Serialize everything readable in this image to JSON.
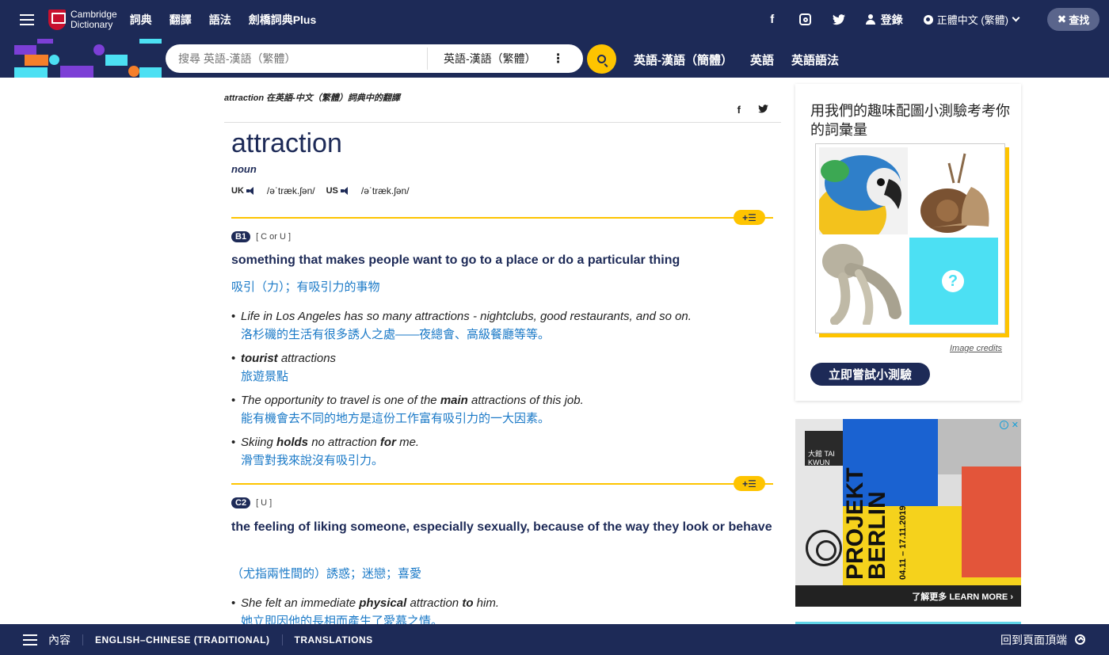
{
  "header": {
    "logo_line1": "Cambridge",
    "logo_line2": "Dictionary",
    "nav": [
      "詞典",
      "翻譯",
      "語法",
      "劍橋詞典Plus"
    ],
    "login": "登錄",
    "language": "正體中文 (繁體)",
    "search_label": "查找"
  },
  "searchbar": {
    "placeholder": "搜尋 英語-漢語（繁體）",
    "dictionary": "英語-漢語（繁體）",
    "links": [
      "英語-漢語（簡體）",
      "英語",
      "英語語法"
    ]
  },
  "entry": {
    "breadcrumb": "attraction 在英語-中文（繁體）詞典中的翻譯",
    "headword": "attraction",
    "pos": "noun",
    "uk_label": "UK",
    "uk_ipa": "/əˈtræk.ʃən/",
    "us_label": "US",
    "us_ipa": "/əˈtræk.ʃən/",
    "senses": [
      {
        "level": "B1",
        "grammar": "[ C or U ]",
        "definition": "something that makes people want to go to a place or do a particular thing",
        "translation": "吸引（力）；有吸引力的事物",
        "examples": [
          {
            "parts": [
              "Life in Los Angeles has so many attractions - nightclubs, good restaurants, and so on."
            ],
            "zh": "洛杉磯的生活有很多誘人之處——夜總會、高級餐廳等等。"
          },
          {
            "parts": [
              "tourist",
              " attractions"
            ],
            "zh": "旅遊景點"
          },
          {
            "parts": [
              "The opportunity to travel is one of the ",
              "main",
              " attractions of this job."
            ],
            "zh": "能有機會去不同的地方是這份工作富有吸引力的一大因素。"
          },
          {
            "parts": [
              "Skiing ",
              "holds",
              " no attraction ",
              "for",
              " me."
            ],
            "zh": "滑雪對我來說沒有吸引力。"
          }
        ]
      },
      {
        "level": "C2",
        "grammar": "[ U ]",
        "definition": "the feeling of liking someone, especially sexually, because of the way they look or behave",
        "translation": "（尤指兩性間的）誘惑；迷戀；喜愛",
        "examples": [
          {
            "parts": [
              "She felt an immediate ",
              "physical",
              " attraction ",
              "to",
              " him."
            ],
            "zh": "她立即因他的長相而產生了愛慕之情。"
          }
        ]
      }
    ]
  },
  "quiz": {
    "title": "用我們的趣味配圖小測驗考考你的詞彙量",
    "credits": "Image credits",
    "button": "立即嘗試小測驗",
    "unknown_symbol": "?"
  },
  "ad": {
    "logo_text": "大館 TAI KWUN",
    "title_line1": "PROJEKT",
    "title_line2": "BERLIN",
    "dates": "04.11 – 17.11.2019",
    "cta": "了解更多 LEARN MORE ›"
  },
  "footer": {
    "contents": "內容",
    "items": [
      "ENGLISH–CHINESE (TRADITIONAL)",
      "TRANSLATIONS"
    ],
    "back_to_top": "回到頁面頂端"
  }
}
